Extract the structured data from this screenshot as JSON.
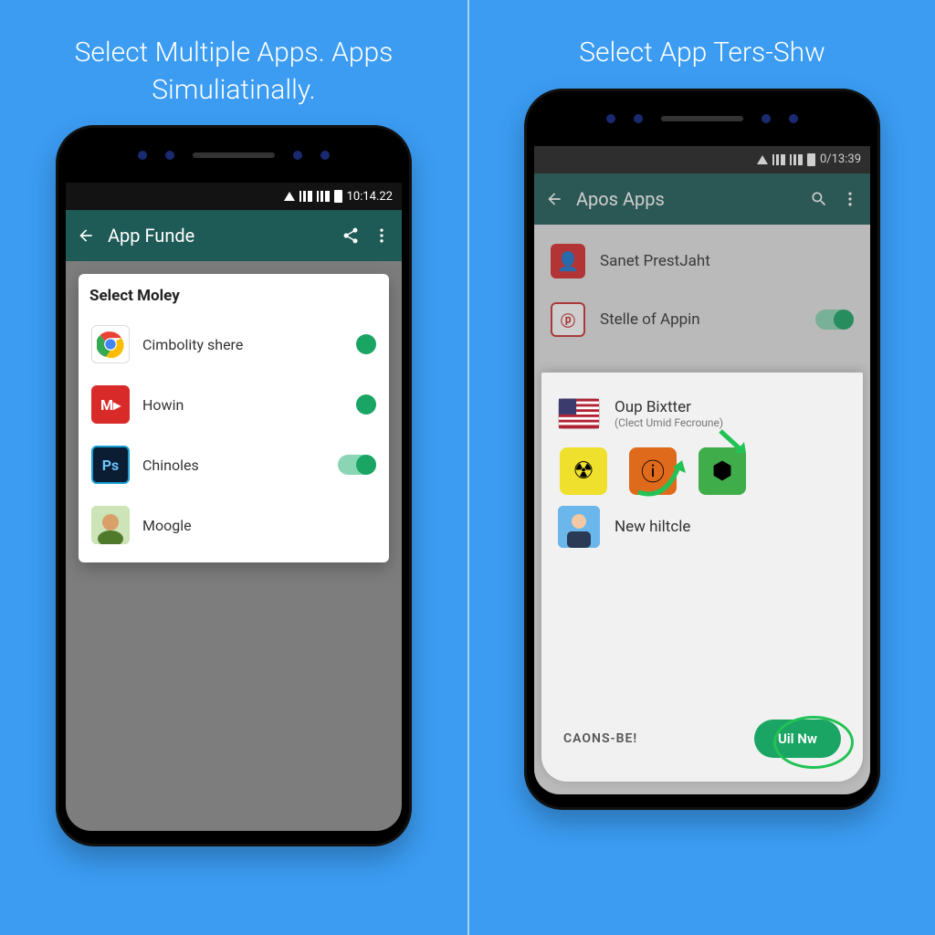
{
  "left": {
    "headline": "Select Multiple Apps. Apps Simuliatinally.",
    "statusbar_time": "10:14.22",
    "appbar_title": "App Funde",
    "card_title": "Select Moley",
    "items": [
      {
        "label": "Cimbolity shere",
        "icon": "chrome"
      },
      {
        "label": "Howin",
        "icon": "red-m"
      },
      {
        "label": "Chinoles",
        "icon": "ps"
      },
      {
        "label": "Moogle",
        "icon": "photo"
      }
    ]
  },
  "right": {
    "headline": "Select App Ters-Shw",
    "statusbar_time": "0/13:39",
    "appbar_title": "Apos Apps",
    "list": [
      {
        "label": "Sanet PrestJaht"
      },
      {
        "label": "Stelle of Appin"
      }
    ],
    "modal": {
      "header_label": "Oup Bixtter",
      "header_sub": "(Clect Umid Fecroune)",
      "last_label": "New hiltcle",
      "cancel": "CAONS-BE!",
      "confirm": "Uil Nw"
    }
  }
}
